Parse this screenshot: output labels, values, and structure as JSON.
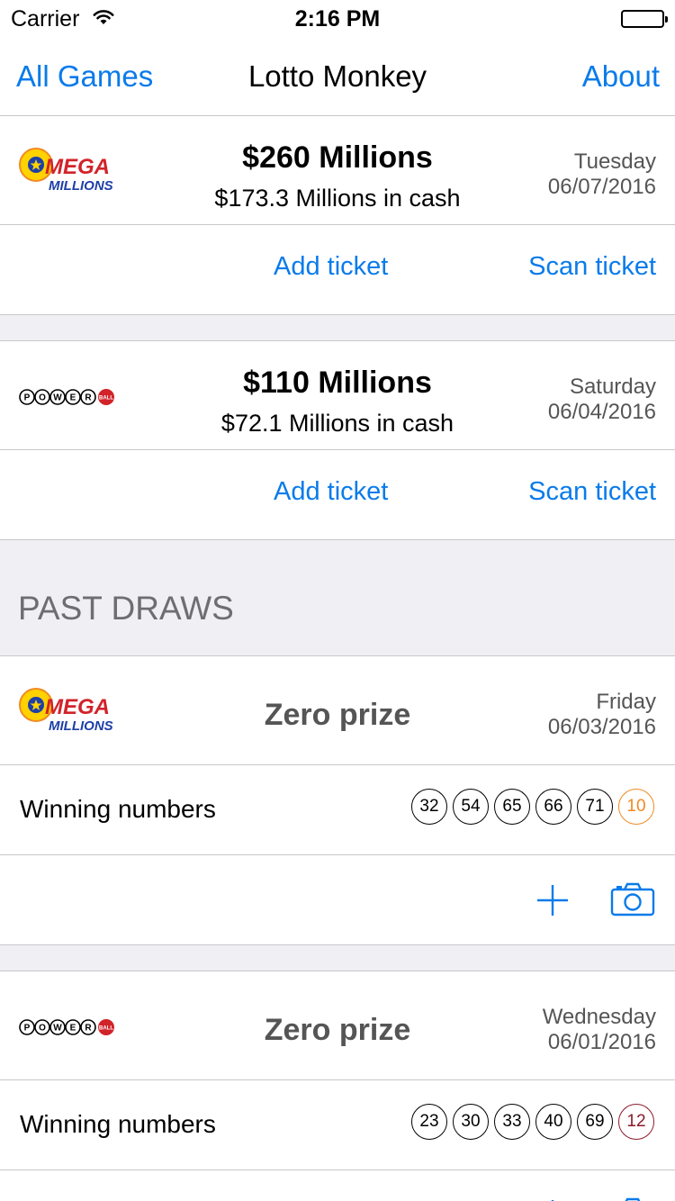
{
  "status_bar": {
    "carrier": "Carrier",
    "time": "2:16 PM"
  },
  "nav": {
    "left": "All Games",
    "title": "Lotto Monkey",
    "right": "About"
  },
  "upcoming": [
    {
      "game": "mega-millions",
      "jackpot": "$260 Millions",
      "cash": "$173.3 Millions in cash",
      "day": "Tuesday",
      "date": "06/07/2016",
      "add": "Add ticket",
      "scan": "Scan ticket"
    },
    {
      "game": "powerball",
      "jackpot": "$110 Millions",
      "cash": "$72.1 Millions in cash",
      "day": "Saturday",
      "date": "06/04/2016",
      "add": "Add ticket",
      "scan": "Scan ticket"
    }
  ],
  "past_header": "PAST DRAWS",
  "past": [
    {
      "game": "mega-millions",
      "result": "Zero prize",
      "day": "Friday",
      "date": "06/03/2016",
      "label": "Winning numbers",
      "numbers": [
        "32",
        "54",
        "65",
        "66",
        "71"
      ],
      "bonus": "10"
    },
    {
      "game": "powerball",
      "result": "Zero prize",
      "day": "Wednesday",
      "date": "06/01/2016",
      "label": "Winning numbers",
      "numbers": [
        "23",
        "30",
        "33",
        "40",
        "69"
      ],
      "bonus": "12"
    }
  ],
  "icons": {
    "add": "plus-icon",
    "scan": "camera-icon",
    "wifi": "wifi-icon",
    "battery": "battery-icon"
  },
  "colors": {
    "accent": "#0a7bea",
    "mega_bonus": "#f08a24",
    "power_bonus": "#8b1a2a"
  },
  "logos": {
    "mega": "MEGA MILLIONS",
    "power": "POWER BALL"
  }
}
